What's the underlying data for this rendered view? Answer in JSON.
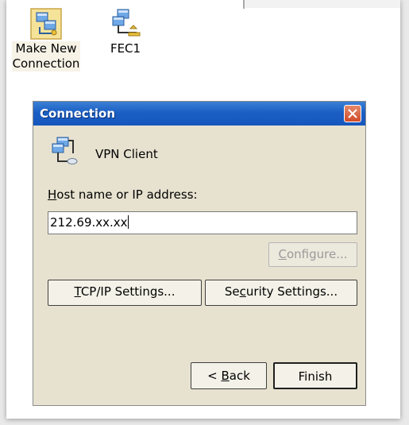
{
  "desktop": {
    "icons": [
      {
        "label_line1": "Make New",
        "label_line2": "Connection",
        "icon": "make-new-connection-icon"
      },
      {
        "label": "FEC1",
        "icon": "network-connection-icon"
      }
    ]
  },
  "dialog": {
    "title": "Connection",
    "connection_type": "VPN Client",
    "host": {
      "label": "Host name or IP address:",
      "value": "212.69.xx.xx"
    },
    "buttons": {
      "configure": "Configure...",
      "tcpip": "TCP/IP Settings...",
      "security": "Security Settings...",
      "back": "< Back",
      "finish": "Finish"
    }
  },
  "colors": {
    "titlebar": "#1b5fc4",
    "dialog_bg": "#e7e2d0",
    "close_button": "#d14b2a"
  }
}
